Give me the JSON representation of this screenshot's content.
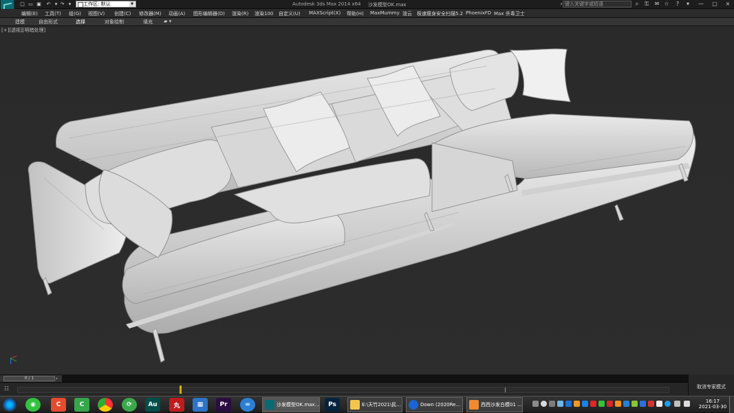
{
  "window": {
    "title": "Autodesk 3ds Max  2014 x64",
    "file": "沙发模型OK.max",
    "workspace": "工作区: 默认",
    "search_placeholder": "键入关键字或短语"
  },
  "menus": [
    "编辑(E)",
    "工具(T)",
    "组(G)",
    "视图(V)",
    "创建(C)",
    "修改器(M)",
    "动画(A)",
    "图形编辑器(D)",
    "渲染(R)",
    "渲染100",
    "自定义(U)",
    "MAXScript(X)",
    "帮助(H)",
    "MaxMummy",
    "渲云",
    "极速瘦身安全扫描5.2",
    "PhoenixFD",
    "Max 杀毒卫士"
  ],
  "ribbon": [
    "建模",
    "自由形式",
    "选择",
    "对象绘制",
    "填充"
  ],
  "viewport": {
    "label": "[+][透视][明暗处理]"
  },
  "timeline": {
    "frame": "0 / 1"
  },
  "status": {
    "mode": "取消专家模式"
  },
  "taskbar": {
    "buttons": [
      "沙发模型OK.max...",
      "E:\\天竹2021\\民...",
      "Down (2020Re...",
      "西西沙发白模01 ..."
    ],
    "time": "16:17",
    "date": "2021-03-30"
  },
  "colors": {
    "accent": "#0a6a73",
    "viewport_bg": "#2b2b2b",
    "timeline_key": "#d4b000"
  },
  "icons": [
    "new-file-icon",
    "open-icon",
    "save-icon",
    "undo-icon",
    "redo-icon",
    "binoculars-icon",
    "favorites-icon",
    "help-icon",
    "axis-gizmo-icon",
    "windows-start-icon"
  ]
}
